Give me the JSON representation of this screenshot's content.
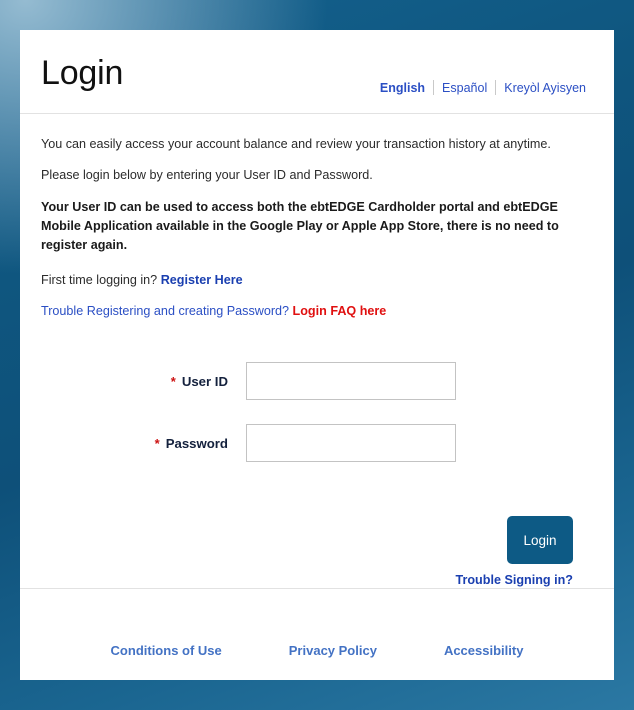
{
  "header": {
    "title": "Login",
    "languages": [
      {
        "label": "English",
        "active": true
      },
      {
        "label": "Español",
        "active": false
      },
      {
        "label": "Kreyòl Ayisyen",
        "active": false
      }
    ]
  },
  "body": {
    "intro_line_1": "You can easily access your account balance and review your transaction history at anytime.",
    "intro_line_2": "Please login below by entering your User ID and Password.",
    "notice": "Your User ID can be used to access both the ebtEDGE Cardholder portal and ebtEDGE Mobile Application available in the Google Play or Apple App Store, there is no need to register again.",
    "register_prompt": "First time logging in?",
    "register_link": "Register Here",
    "faq_prompt": "Trouble Registering and creating Password?",
    "faq_link": "Login FAQ here"
  },
  "form": {
    "required_marker": "*",
    "user_id_label": "User ID",
    "user_id_value": "",
    "user_id_placeholder": "",
    "password_label": "Password",
    "password_value": "",
    "password_placeholder": "",
    "submit_label": "Login",
    "trouble_link": "Trouble Signing in?"
  },
  "footer": {
    "links": [
      {
        "label": "Conditions of Use"
      },
      {
        "label": "Privacy Policy"
      },
      {
        "label": "Accessibility"
      }
    ]
  },
  "colors": {
    "accent_button": "#0d5a85",
    "link_blue": "#2b4fc4",
    "link_blue_bold": "#1a3fb0",
    "footer_link": "#4372c4",
    "required_red": "#cc1111",
    "faq_red": "#e01010",
    "page_bg_dark": "#0e5079",
    "page_bg_light": "#8fb6cf",
    "card_bg": "#ffffff",
    "input_border": "#c3c3c3",
    "divider": "#e2e2e2"
  }
}
